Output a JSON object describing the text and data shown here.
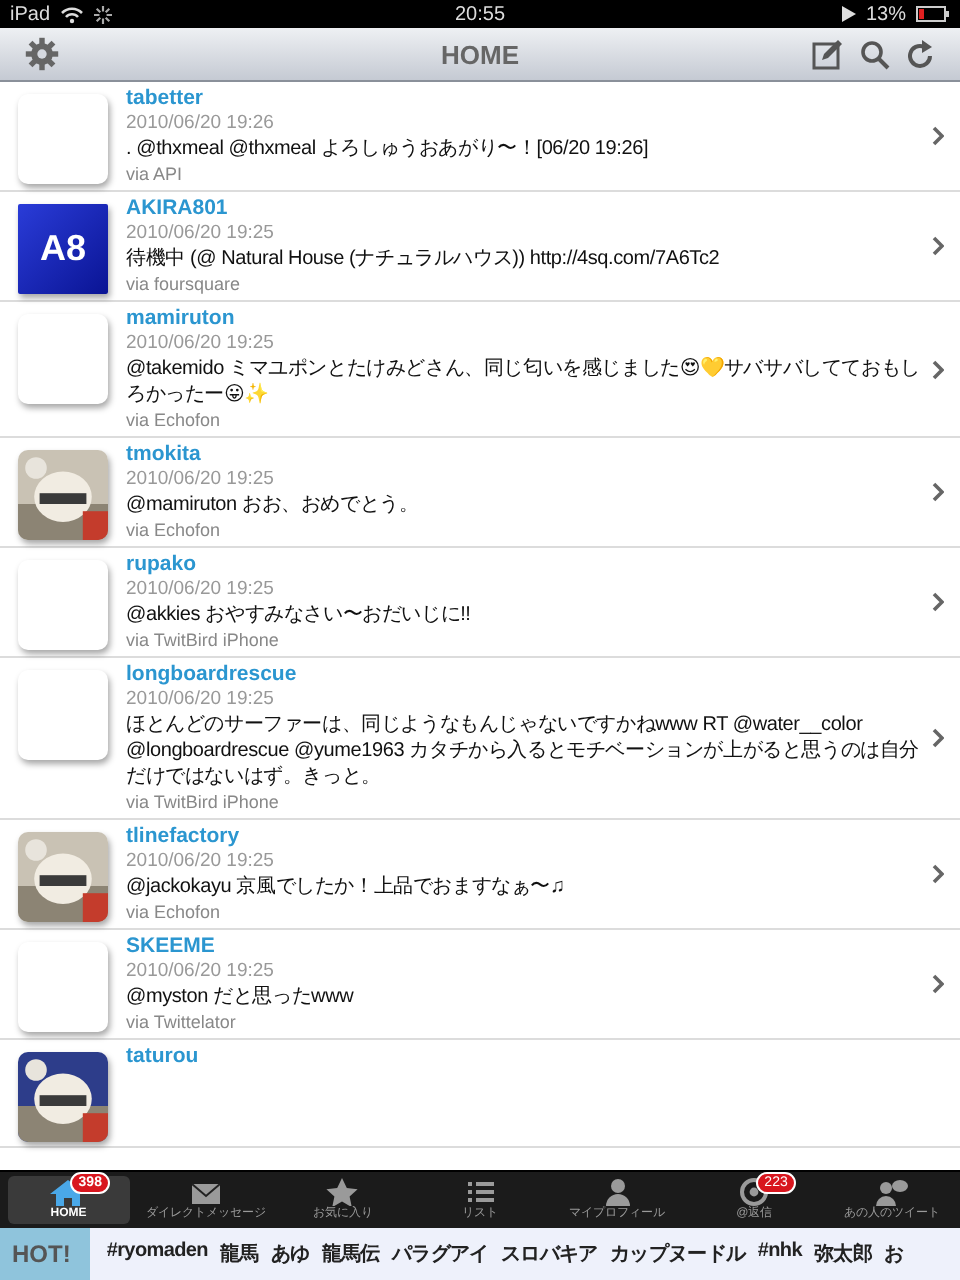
{
  "status_bar": {
    "device": "iPad",
    "time": "20:55",
    "battery": "13%"
  },
  "nav": {
    "title": "HOME"
  },
  "tweets": [
    {
      "user": "tabetter",
      "time": "2010/06/20 19:26",
      "text": ". @thxmeal @thxmeal よろしゅうおあがり〜！[06/20 19:26]",
      "via": "via API",
      "avatar": {
        "kind": "blank"
      }
    },
    {
      "user": "AKIRA801",
      "time": "2010/06/20 19:25",
      "text": "待機中 (@ Natural House (ナチュラルハウス)) http://4sq.com/7A6Tc2",
      "via": "via foursquare",
      "avatar": {
        "kind": "text",
        "text": "A8"
      }
    },
    {
      "user": "mamiruton",
      "time": "2010/06/20 19:25",
      "text": "@takemido ミマユポンとたけみどさん、同じ匂いを感じました😍💛サバサバしてておもしろかったー😛✨",
      "via": "via Echofon",
      "avatar": {
        "kind": "blank"
      }
    },
    {
      "user": "tmokita",
      "time": "2010/06/20 19:25",
      "text": "@mamiruton おお、おめでとう。",
      "via": "via Echofon"
    },
    {
      "user": "rupako",
      "time": "2010/06/20 19:25",
      "text": "@akkies おやすみなさい〜おだいじに!!",
      "via": "via TwitBird iPhone",
      "avatar": {
        "kind": "blank"
      }
    },
    {
      "user": "longboardrescue",
      "time": "2010/06/20 19:25",
      "text": "ほとんどのサーファーは、同じようなもんじゃないですかねwww RT @water__color @longboardrescue @yume1963 カタチから入るとモチベーションが上がると思うのは自分だけではないはず。きっと。",
      "via": "via TwitBird iPhone",
      "avatar": {
        "kind": "blank"
      }
    },
    {
      "user": "tlinefactory",
      "time": "2010/06/20 19:25",
      "text": "@jackokayu 京風でしたか！上品でおますなぁ〜♫",
      "via": "via Echofon"
    },
    {
      "user": "SKEEME",
      "time": "2010/06/20 19:25",
      "text": "@myston だと思ったwww",
      "via": "via Twittelator",
      "avatar": {
        "kind": "blank"
      }
    },
    {
      "user": "taturou"
    }
  ],
  "tabs": [
    {
      "label": "HOME",
      "badge": "398",
      "selected": true
    },
    {
      "label": "ダイレクトメッセージ",
      "selected": false
    },
    {
      "label": "お気に入り",
      "selected": false
    },
    {
      "label": "リスト",
      "selected": false
    },
    {
      "label": "マイプロフィール",
      "selected": false
    },
    {
      "label": "@返信",
      "badge": "223",
      "selected": false
    },
    {
      "label": "あの人のツイート",
      "selected": false
    }
  ],
  "hot": {
    "label": "HOT!",
    "topics": [
      "#ryomaden",
      "龍馬",
      "あゆ",
      "龍馬伝",
      "パラグアイ",
      "スロバキア",
      "カップヌードル",
      "#nhk",
      "弥太郎",
      "お"
    ]
  }
}
